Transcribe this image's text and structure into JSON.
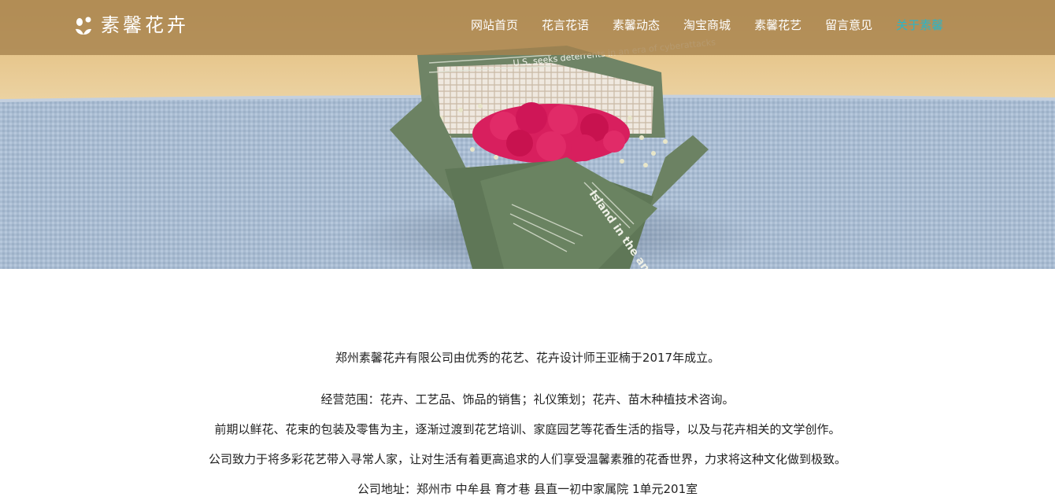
{
  "brand": {
    "name": "素馨花卉",
    "logo_icon": "flower-sprout-icon"
  },
  "nav": {
    "items": [
      {
        "label": "网站首页"
      },
      {
        "label": "花言花语"
      },
      {
        "label": "素馨动态"
      },
      {
        "label": "淘宝商城"
      },
      {
        "label": "素馨花艺"
      },
      {
        "label": "留言意见"
      },
      {
        "label": "关于素馨"
      }
    ],
    "active_index": 6,
    "active_color": "#2bb5c7"
  },
  "hero": {
    "wrapper_print_1": "U.S. seeks deterrents in an era of cyberattacks",
    "wrapper_print_2": "Island in the antiquities"
  },
  "about": {
    "intro": "郑州素馨花卉有限公司由优秀的花艺、花卉设计师王亚楠于2017年成立。",
    "scope": "经营范围：花卉、工艺品、饰品的销售；礼仪策划；花卉、苗木种植技术咨询。",
    "history": "前期以鲜花、花束的包装及零售为主，逐渐过渡到花艺培训、家庭园艺等花香生活的指导，以及与花卉相关的文学创作。",
    "mission": "公司致力于将多彩花艺带入寻常人家，让对生活有着更高追求的人们享受温馨素雅的花香世界，力求将这种文化做到极致。",
    "address": "公司地址：郑州市 中牟县 育才巷 县直一初中家属院 1单元201室"
  }
}
